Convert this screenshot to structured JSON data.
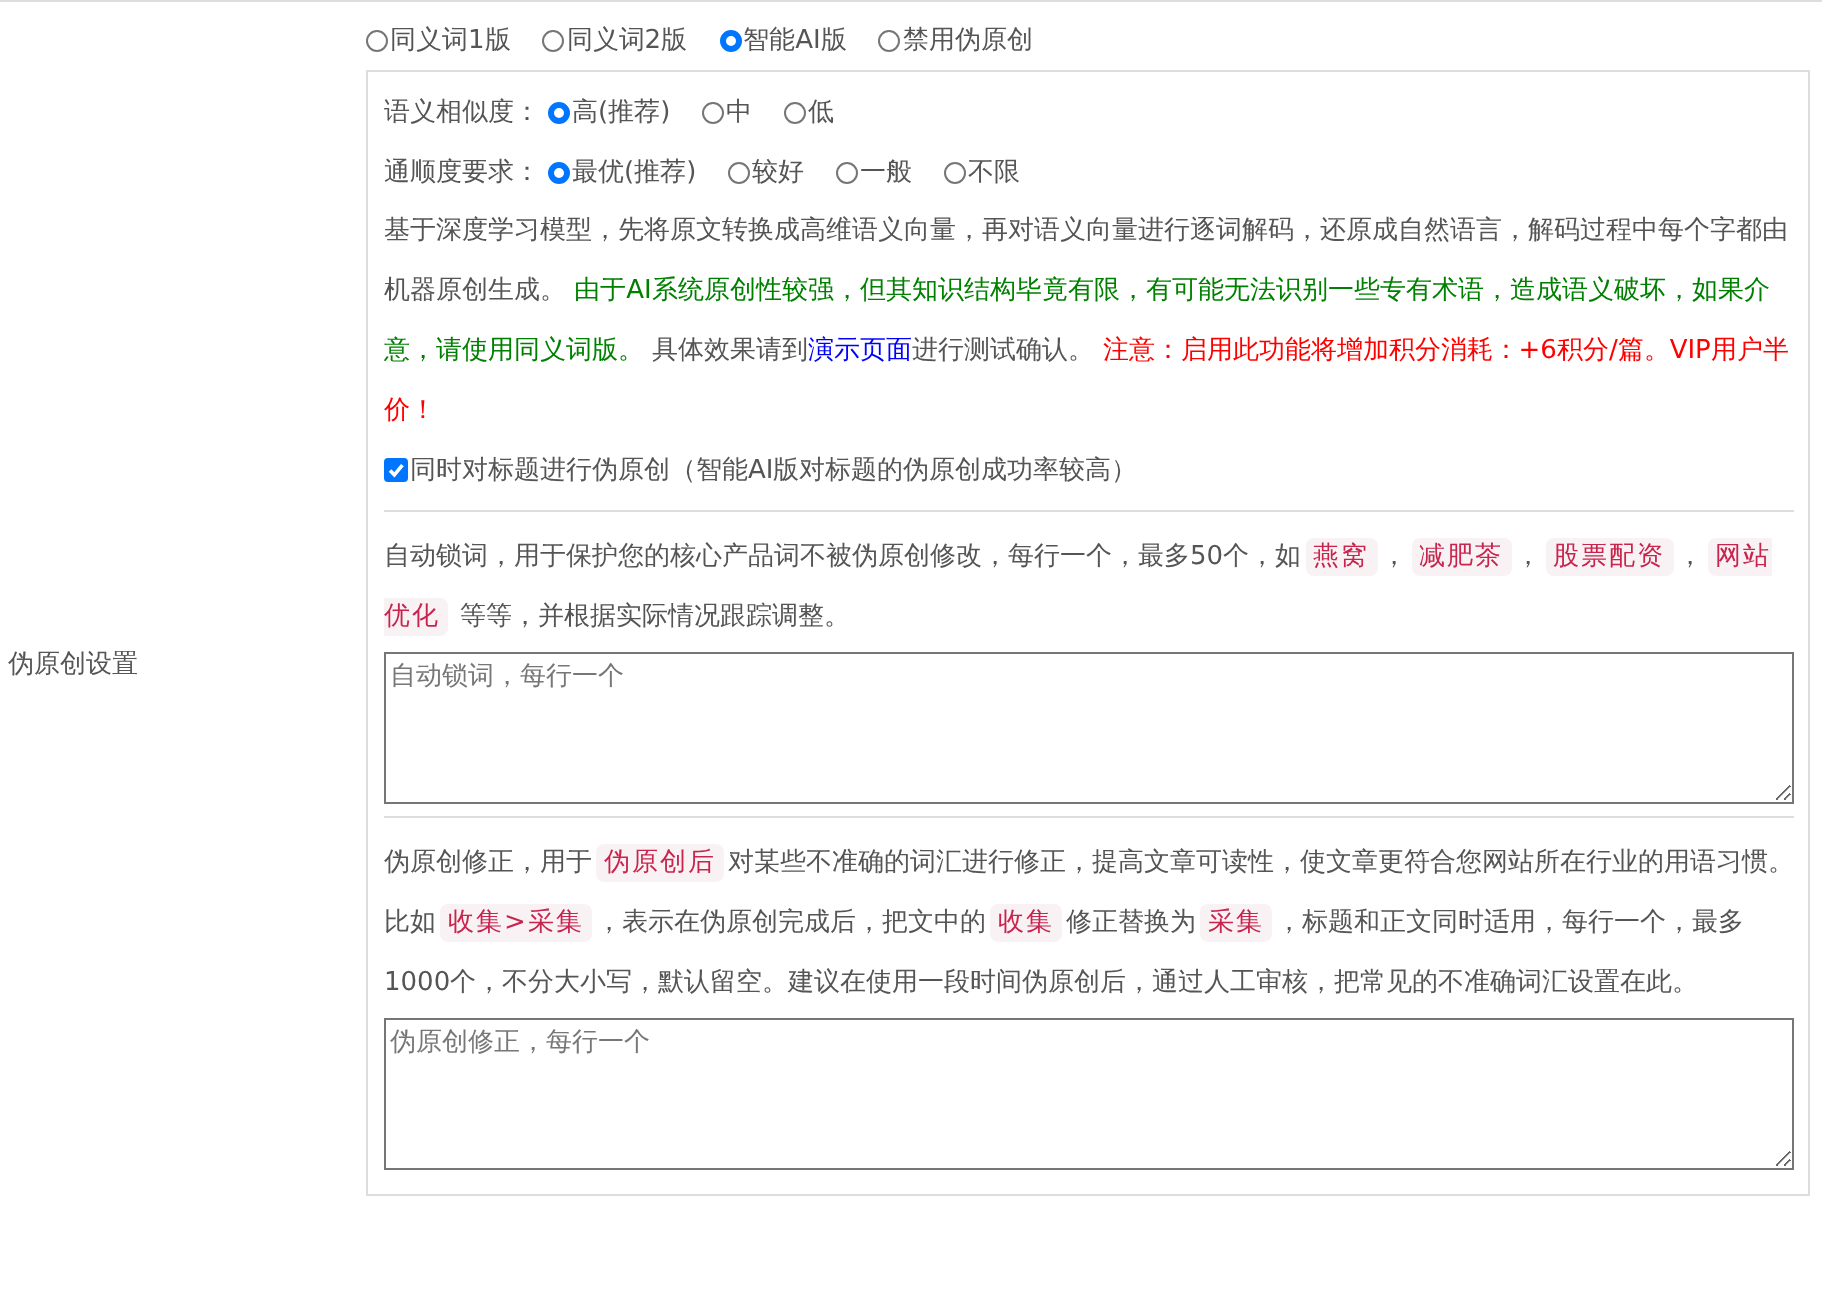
{
  "label": "伪原创设置",
  "modes": [
    {
      "label": "同义词1版",
      "selected": false
    },
    {
      "label": "同义词2版",
      "selected": false
    },
    {
      "label": "智能AI版",
      "selected": true
    },
    {
      "label": "禁用伪原创",
      "selected": false
    }
  ],
  "options": [
    {
      "label": "语义相似度：",
      "choices": [
        {
          "label": "高(推荐)",
          "selected": true
        },
        {
          "label": "中",
          "selected": false
        },
        {
          "label": "低",
          "selected": false
        }
      ]
    },
    {
      "label": "通顺度要求：",
      "choices": [
        {
          "label": "最优(推荐)",
          "selected": true
        },
        {
          "label": "较好",
          "selected": false
        },
        {
          "label": "一般",
          "selected": false
        },
        {
          "label": "不限",
          "selected": false
        }
      ]
    }
  ],
  "description": [
    {
      "kind": "plain",
      "text": "基于深度学习模型，先将原文转换成高维语义向量，再对语义向量进行逐词解码，还原成自然语言，解码过程中每个字都由机器原创生成。 "
    },
    {
      "kind": "notice",
      "text": "由于AI系统原创性较强，但其知识结构毕竟有限，有可能无法识别一些专有术语，造成语义破坏，如果介意，请使用同义词版。"
    },
    {
      "kind": "plain",
      "text": " 具体效果请到"
    },
    {
      "kind": "link",
      "text": "演示页面"
    },
    {
      "kind": "plain",
      "text": "进行测试确认。 "
    },
    {
      "kind": "warning",
      "text": "注意：启用此功能将增加积分消耗：+6积分/篇。VIP用户半价！"
    }
  ],
  "title_option": {
    "label": "同时对标题进行伪原创（智能AI版对标题的伪原创成功率较高）",
    "checked": true
  },
  "word_sections": [
    {
      "description": [
        {
          "kind": "plain",
          "text": "自动锁词，用于保护您的核心产品词不被伪原创修改，每行一个，最多50个，如"
        },
        {
          "kind": "code",
          "text": "燕窝"
        },
        {
          "kind": "plain",
          "text": "，"
        },
        {
          "kind": "code",
          "text": "减肥茶"
        },
        {
          "kind": "plain",
          "text": "，"
        },
        {
          "kind": "code",
          "text": "股票配资"
        },
        {
          "kind": "plain",
          "text": "，"
        },
        {
          "kind": "code",
          "text": "网站优化"
        },
        {
          "kind": "plain",
          "text": " 等等，并根据实际情况跟踪调整。"
        }
      ],
      "placeholder": "自动锁词，每行一个"
    },
    {
      "description": [
        {
          "kind": "plain",
          "text": "伪原创修正，用于"
        },
        {
          "kind": "code",
          "text": "伪原创后"
        },
        {
          "kind": "plain",
          "text": "对某些不准确的词汇进行修正，提高文章可读性，使文章更符合您网站所在行业的用语习惯。比如"
        },
        {
          "kind": "code",
          "text": "收集>采集"
        },
        {
          "kind": "plain",
          "text": "，表示在伪原创完成后，把文中的"
        },
        {
          "kind": "code",
          "text": "收集"
        },
        {
          "kind": "plain",
          "text": "修正替换为"
        },
        {
          "kind": "code",
          "text": "采集"
        },
        {
          "kind": "plain",
          "text": "，标题和正文同时适用，每行一个，最多1000个，不分大小写，默认留空。建议在使用一段时间伪原创后，通过人工审核，把常见的不准确词汇设置在此。"
        }
      ],
      "placeholder": "伪原创修正，每行一个"
    }
  ]
}
